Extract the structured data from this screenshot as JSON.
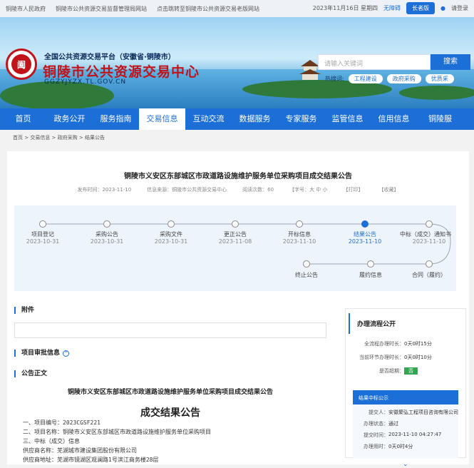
{
  "topbar": {
    "links": [
      "铜陵市人民政府",
      "铜陵市公共资源交易监督管理局网站",
      "点击跳转至铜陵市公共资源交易老版网站"
    ],
    "date": "2023年11月16日 星期四",
    "accessible": "无障碍",
    "elder_mode": "长者版",
    "login": "请登录"
  },
  "header": {
    "subtitle": "全国公共资源交易平台（安徽省·铜陵市）",
    "title": "铜陵市公共资源交易中心",
    "domain": "GGZYJYZX.TL.GOV.CN",
    "logo_char": "阖",
    "search_placeholder": "请输入关键词",
    "search_button": "搜索",
    "hot_label": "热搜词:",
    "hot_tags": [
      "工程建设",
      "政府采购",
      "优质采"
    ]
  },
  "nav": [
    "首页",
    "政务公开",
    "服务指南",
    "交易信息",
    "互动交流",
    "数据服务",
    "专家服务",
    "监管信息",
    "信用信息",
    "铜陵服"
  ],
  "nav_active_index": 3,
  "breadcrumb": "首页 > 交易信息 > 政府采购 > 结果公告",
  "article": {
    "title": "铜陵市义安区东部城区市政道路设施维护服务单位采购项目成交结果公告",
    "meta": [
      "发布时间：2023-11-10",
      "信息来源：铜陵市公共资源交易中心",
      "阅读次数：60",
      "【字号：大 中 小",
      "【打印】",
      "【收藏】"
    ]
  },
  "timeline": {
    "nodes": [
      {
        "label": "项目登记",
        "date": "2023-10-31",
        "active": false
      },
      {
        "label": "采购公告",
        "date": "2023-10-31",
        "active": false
      },
      {
        "label": "采购文件",
        "date": "2023-10-31",
        "active": false
      },
      {
        "label": "更正公告",
        "date": "2023-11-08",
        "active": false
      },
      {
        "label": "开标信息",
        "date": "2023-11-10",
        "active": false
      },
      {
        "label": "结果公告",
        "date": "2023-11-10",
        "active": true
      },
      {
        "label": "中标（成交）通知书",
        "date": "2023-11-10",
        "active": false
      }
    ],
    "lower": [
      "终止公告",
      "履约信息",
      "合同（履约）"
    ]
  },
  "sections": {
    "attachment": "附件",
    "approval": "项目审批信息",
    "body": "公告正文"
  },
  "body": {
    "subtitle": "铜陵市义安区东部城区市政道路设施维护服务单位采购项目成交结果公告",
    "big_title": "成交结果公告",
    "lines": [
      "一、项目编号：2023CGSF221",
      "二、项目名称：铜陵市义安区东部城区市政道路设施维护服务单位采购项目",
      "三、中标（成交）信息",
      "供应商名称：芜湖城市建设集团股份有限公司",
      "供应商地址：芜湖市镜湖区观澜路1号滨江商务楼28层"
    ]
  },
  "side": {
    "title": "办理流程公开",
    "rows": [
      {
        "k": "全流程办理时长：",
        "v": "0天0时15分"
      },
      {
        "k": "当前环节办理时长：",
        "v": "0天0时10分"
      },
      {
        "k": "是否超期：",
        "v": "否"
      }
    ],
    "win": {
      "title": "结果中标公示",
      "rows": [
        {
          "k": "提交人：",
          "v": "安徽聚弘工程项目咨询有限公司"
        },
        {
          "k": "办理状态：",
          "v": "通过"
        },
        {
          "k": "提交时间：",
          "v": "2023-11-10 04:27:47"
        },
        {
          "k": "办理用时：",
          "v": "0天0时4分"
        }
      ]
    }
  }
}
